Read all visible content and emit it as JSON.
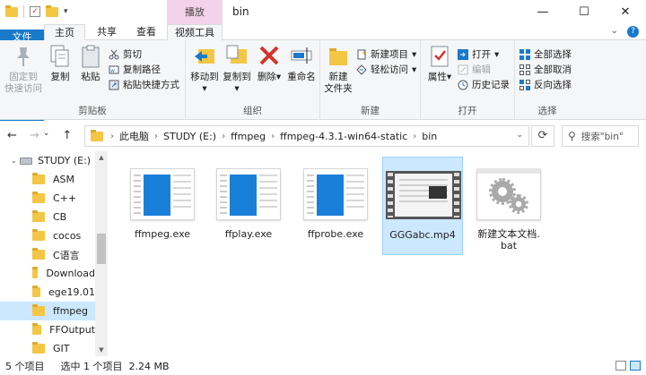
{
  "window": {
    "title": "bin",
    "contextual_tab": "播放",
    "controls": {
      "minimize": "—",
      "maximize": "☐",
      "close": "✕"
    },
    "quick_access": {
      "dropdown": "▾"
    }
  },
  "tabs": {
    "items": [
      "文件",
      "主页",
      "共享",
      "查看",
      "视频工具"
    ],
    "active": "主页",
    "right": {
      "expand": "⌄",
      "help": "?"
    }
  },
  "ribbon": {
    "clipboard": {
      "label": "剪贴板",
      "pin": "固定到\n快速访问",
      "copy": "复制",
      "paste": "粘贴",
      "cut": "剪切",
      "copy_path": "复制路径",
      "paste_shortcut": "粘贴快捷方式"
    },
    "organize": {
      "label": "组织",
      "move_to": "移动到",
      "copy_to": "复制到",
      "delete": "删除",
      "rename": "重命名",
      "dropdown": "▾"
    },
    "new": {
      "label": "新建",
      "new_folder": "新建\n文件夹",
      "new_item": "新建项目",
      "easy_access": "轻松访问",
      "dropdown": "▾"
    },
    "open": {
      "label": "打开",
      "properties": "属性",
      "open": "打开",
      "edit": "编辑",
      "history": "历史记录",
      "dropdown": "▾"
    },
    "select": {
      "label": "选择",
      "select_all": "全部选择",
      "select_none": "全部取消",
      "invert": "反向选择"
    }
  },
  "address": {
    "crumbs": [
      "此电脑",
      "STUDY (E:)",
      "ffmpeg",
      "ffmpeg-4.3.1-win64-static",
      "bin"
    ],
    "search_placeholder": "搜索\"bin\"",
    "nav": {
      "back": "←",
      "forward": "→",
      "recent": "⌄",
      "up": "↑"
    },
    "chevron": "›",
    "dropdown": "⌄",
    "refresh": "⟳",
    "search_icon": "⚲"
  },
  "navpane": {
    "expand": "⌄",
    "drive": "STUDY (E:)",
    "folders": [
      "ASM",
      "C++",
      "CB",
      "cocos",
      "C语言",
      "Download",
      "ege19.01",
      "ffmpeg",
      "FFOutput",
      "GIT"
    ],
    "selected": "ffmpeg",
    "scroll": {
      "up": "▲",
      "down": "▼"
    }
  },
  "files": [
    {
      "name": "ffmpeg.exe",
      "kind": "exe"
    },
    {
      "name": "ffplay.exe",
      "kind": "exe"
    },
    {
      "name": "ffprobe.exe",
      "kind": "exe"
    },
    {
      "name": "GGGabc.mp4",
      "kind": "video",
      "selected": true
    },
    {
      "name": "新建文本文档.\nbat",
      "kind": "bat"
    }
  ],
  "status": {
    "count": "5 个项目",
    "selection": "选中 1 个项目  2.24 MB"
  },
  "colors": {
    "accent": "#1979ca",
    "selection": "#cce8ff",
    "contextual": "#f3d3ea",
    "folder": "#f3c645"
  }
}
